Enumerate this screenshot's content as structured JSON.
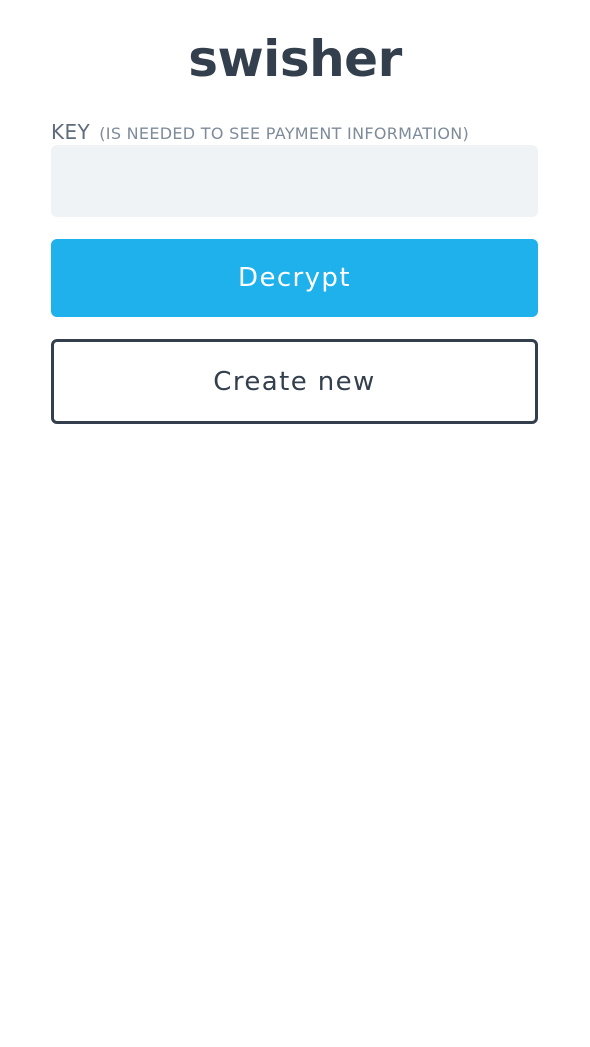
{
  "app": {
    "logo_text": "swisher"
  },
  "key_field": {
    "label": "KEY",
    "hint": "(IS NEEDED TO SEE PAYMENT INFORMATION)",
    "value": "",
    "placeholder": ""
  },
  "buttons": {
    "decrypt_label": "Decrypt",
    "create_new_label": "Create new"
  },
  "colors": {
    "brand_text": "#333f4d",
    "accent": "#1eb1ec",
    "input_background": "#f0f3f6",
    "label": "#5f6c7b"
  }
}
